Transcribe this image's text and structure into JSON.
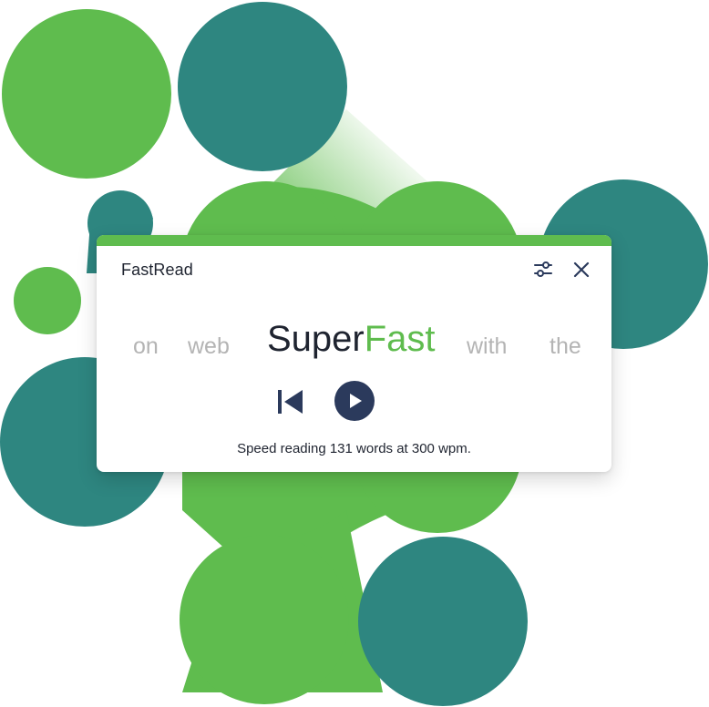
{
  "colors": {
    "green": "#5fbc4e",
    "teal": "#2e8680",
    "navy": "#2b3a5c",
    "muted_word": "#b4b4b4",
    "text": "#1f2430"
  },
  "app": {
    "title": "FastRead",
    "settings_icon": "sliders-icon",
    "close_icon": "close-icon"
  },
  "reader": {
    "words_before": [
      "on",
      "web"
    ],
    "current_word_prefix": "Super",
    "current_word_highlight": "Fast",
    "words_after": [
      "with",
      "the"
    ]
  },
  "controls": {
    "rewind_icon": "skip-back-icon",
    "play_icon": "play-icon"
  },
  "status": "Speed reading 131 words at 300 wpm."
}
